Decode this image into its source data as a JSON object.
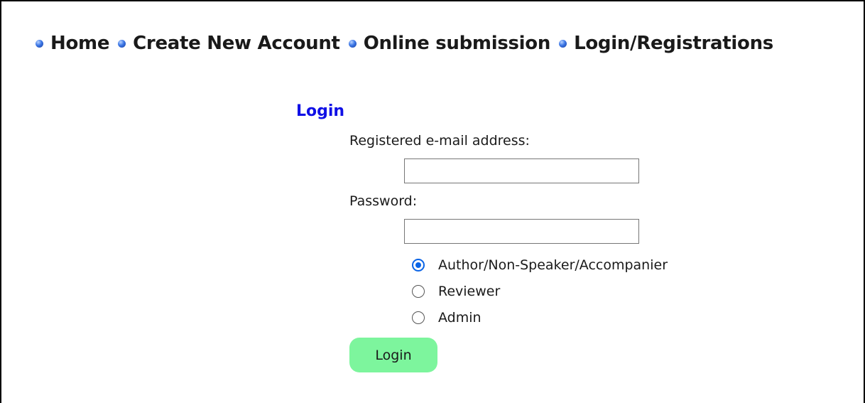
{
  "nav": {
    "items": [
      {
        "label": "Home"
      },
      {
        "label": "Create New Account"
      },
      {
        "label": "Online submission"
      },
      {
        "label": "Login/Registrations"
      }
    ]
  },
  "login_form": {
    "title": "Login",
    "email_label": "Registered e-mail address:",
    "email_value": "",
    "password_label": "Password:",
    "password_value": "",
    "roles": [
      {
        "label": "Author/Non-Speaker/Accompanier",
        "checked": true
      },
      {
        "label": "Reviewer",
        "checked": false
      },
      {
        "label": "Admin",
        "checked": false
      }
    ],
    "submit_label": "Login"
  },
  "colors": {
    "title": "#1010e6",
    "button_bg": "#7df59d",
    "radio_selected": "#0a64e6"
  }
}
